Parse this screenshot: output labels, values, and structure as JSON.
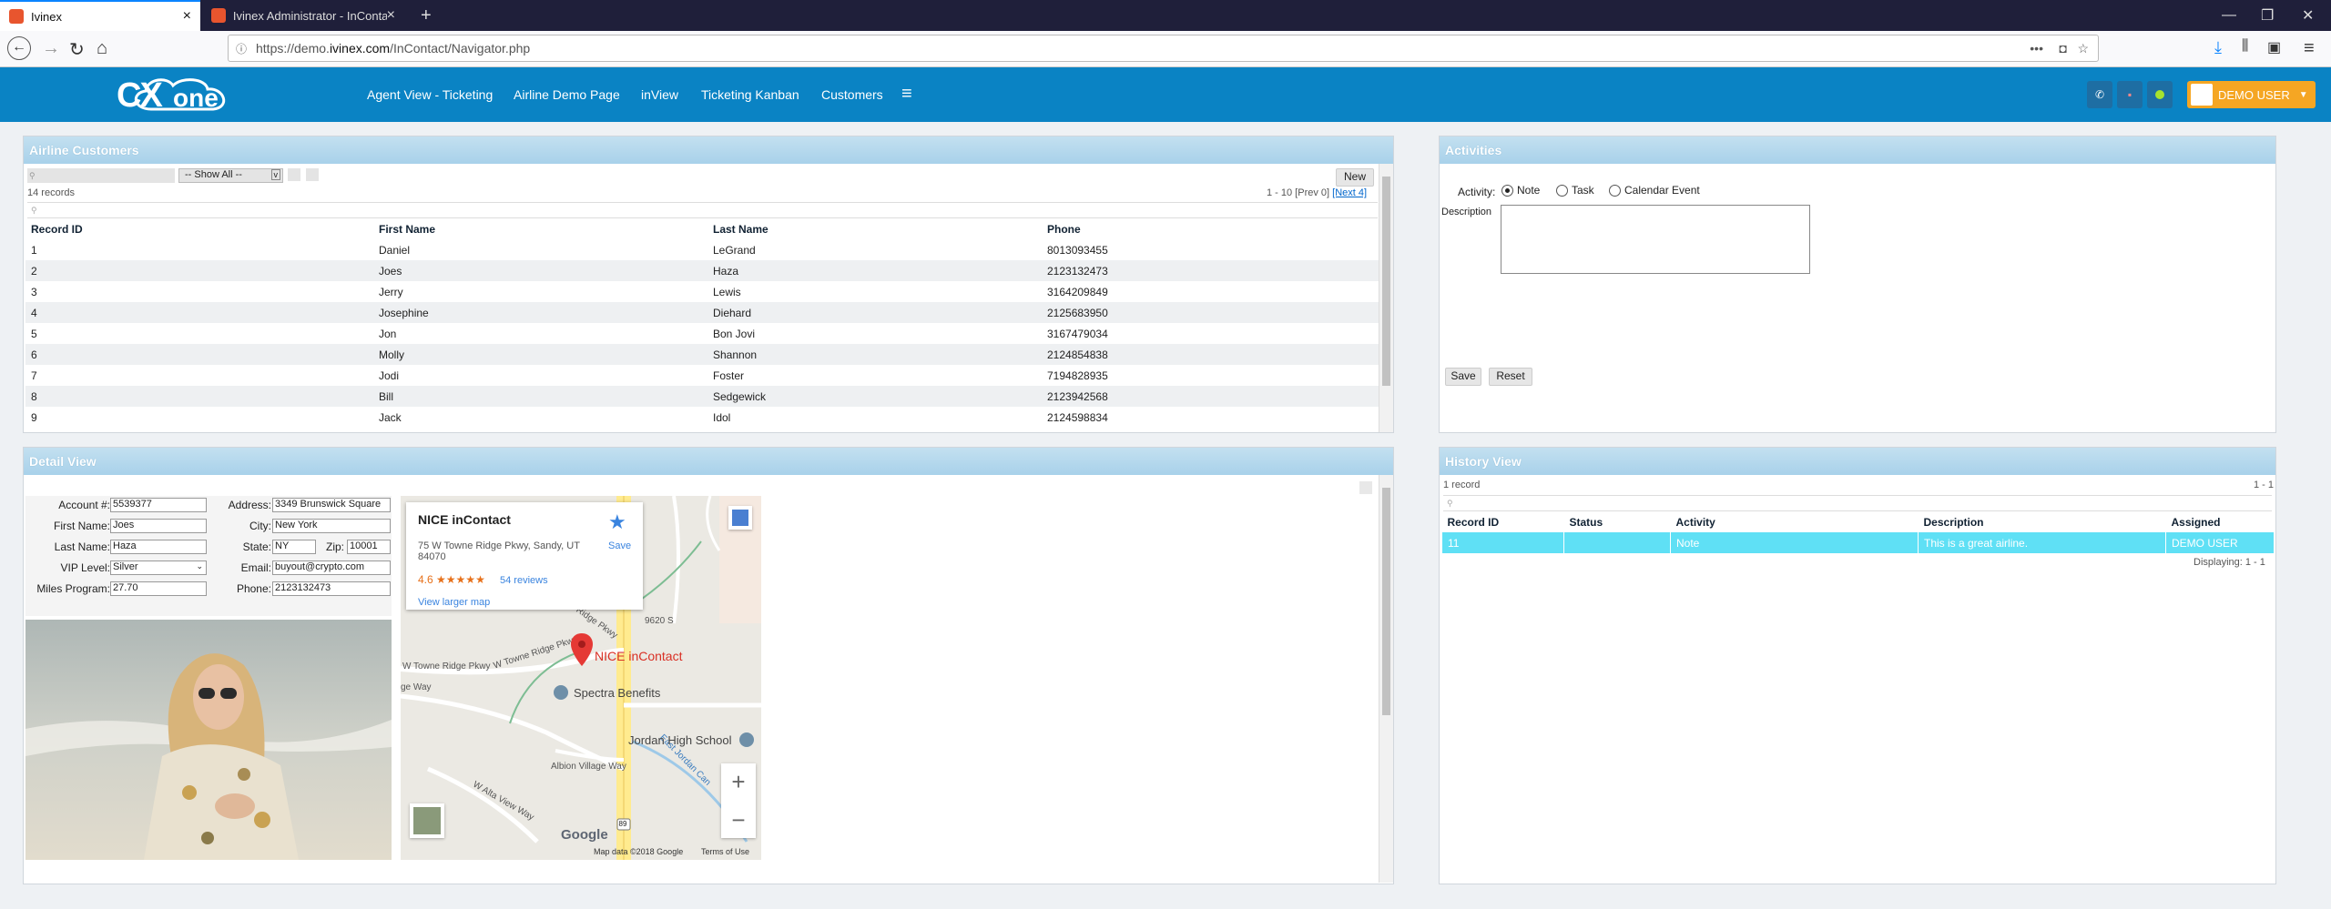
{
  "browser": {
    "tabs": [
      {
        "title": "Ivinex"
      },
      {
        "title": "Ivinex Administrator - InContac"
      }
    ],
    "new_tab": "+",
    "url_prefix": "https://demo.",
    "url_host": "ivinex.com",
    "url_path": "/InContact/Navigator.php",
    "url_more": "•••"
  },
  "app": {
    "logo_cx": "CX",
    "logo_one": "one",
    "menu": [
      "Agent View - Ticketing",
      "Airline Demo Page",
      "inView",
      "Ticketing Kanban",
      "Customers"
    ],
    "user": "DEMO USER",
    "colors": {
      "header": "#0a83c4",
      "user": "#f5a623",
      "status": "#a6e22e",
      "highlight": "#5fe0f5"
    }
  },
  "airline": {
    "title": "Airline Customers",
    "filter_select": "-- Show All --",
    "new_label": "New",
    "record_count": "14 records",
    "paging_prefix": "1 - 10 [Prev 0] ",
    "paging_next": "[Next 4]",
    "columns": [
      "Record ID",
      "First Name",
      "Last Name",
      "Phone"
    ],
    "rows": [
      [
        "1",
        "Daniel",
        "LeGrand",
        "8013093455"
      ],
      [
        "2",
        "Joes",
        "Haza",
        "2123132473"
      ],
      [
        "3",
        "Jerry",
        "Lewis",
        "3164209849"
      ],
      [
        "4",
        "Josephine",
        "Diehard",
        "2125683950"
      ],
      [
        "5",
        "Jon",
        "Bon Jovi",
        "3167479034"
      ],
      [
        "6",
        "Molly",
        "Shannon",
        "2124854838"
      ],
      [
        "7",
        "Jodi",
        "Foster",
        "7194828935"
      ],
      [
        "8",
        "Bill",
        "Sedgewick",
        "2123942568"
      ],
      [
        "9",
        "Jack",
        "Idol",
        "2124598834"
      ]
    ]
  },
  "activities": {
    "title": "Activities",
    "activity_label": "Activity:",
    "options": [
      "Note",
      "Task",
      "Calendar Event"
    ],
    "description_label": "Description",
    "save": "Save",
    "reset": "Reset"
  },
  "detail": {
    "title": "Detail View",
    "fields": {
      "account_label": "Account #:",
      "account": "5539377",
      "first_label": "First Name:",
      "first": "Joes",
      "last_label": "Last Name:",
      "last": "Haza",
      "vip_label": "VIP Level:",
      "vip": "Silver",
      "miles_label": "Miles Program:",
      "miles": "27.70",
      "address_label": "Address:",
      "address": "3349 Brunswick Square",
      "city_label": "City:",
      "city": "New York",
      "state_label": "State:",
      "state": "NY",
      "zip_label": "Zip:",
      "zip": "10001",
      "email_label": "Email:",
      "email": "buyout@crypto.com",
      "phone_label": "Phone:",
      "phone": "2123132473"
    },
    "map": {
      "place": "NICE inContact",
      "address": "75 W Towne Ridge Pkwy, Sandy, UT 84070",
      "rating": "4.6",
      "stars": "★★★★★",
      "reviews": "54 reviews",
      "save": "Save",
      "larger": "View larger map",
      "pin_label": "NICE inContact",
      "spectra": "Spectra Benefits",
      "school": "Jordan High School",
      "road1": "W Towne Ridge Pkwy",
      "road2": "W Towne Ridge Pkwy",
      "road3": "Towne Ridge Pkwy",
      "road4": "Albion Village Way",
      "road5": "W Alta View Way",
      "road6": "East Jordan Can",
      "road7": "9620 S",
      "road8": "ge Way",
      "shield": "89",
      "google": "Google",
      "mapdata": "Map data ©2018 Google",
      "terms": "Terms of Use",
      "zoom_in": "+",
      "zoom_out": "−"
    }
  },
  "history": {
    "title": "History View",
    "record_count": "1 record",
    "paging": "1 - 1",
    "columns": [
      "Record ID",
      "Status",
      "Activity",
      "Description",
      "Assigned"
    ],
    "rows": [
      [
        "11",
        "",
        "Note",
        "This is a great airline.",
        "DEMO USER"
      ]
    ],
    "displaying": "Displaying: 1 - 1"
  }
}
